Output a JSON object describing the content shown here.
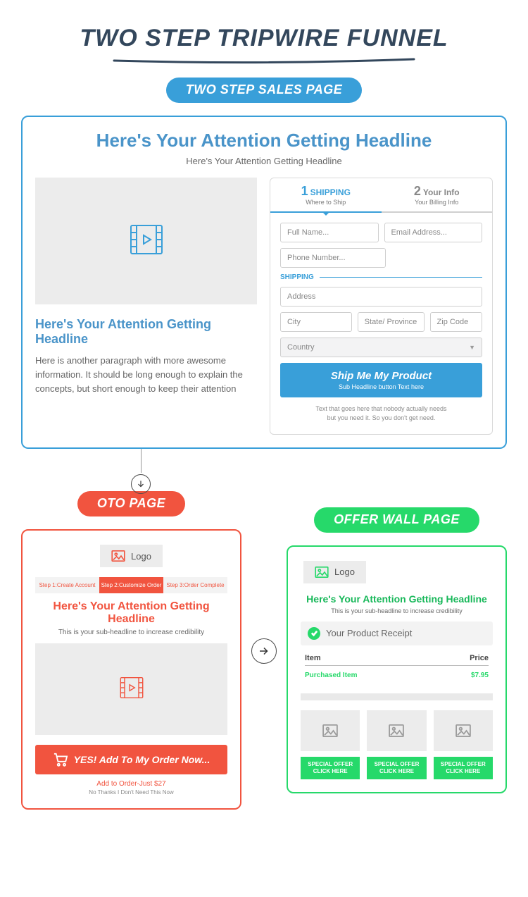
{
  "title": "Two Step Tripwire Funnel",
  "sales": {
    "pill": "Two Step Sales Page",
    "headline": "Here's Your Attention Getting Headline",
    "subhead": "Here's Your Attention Getting Headline",
    "left_headline": "Here's Your Attention Getting Headline",
    "left_para": "Here is another paragraph with more awesome information. It should be long enough to explain the concepts, but short enough to keep their attention",
    "tab1_num": "1",
    "tab1_title": "SHIPPING",
    "tab1_sub": "Where to Ship",
    "tab2_num": "2",
    "tab2_title": "Your Info",
    "tab2_sub": "Your Billing Info",
    "ph_fullname": "Full Name...",
    "ph_email": "Email Address...",
    "ph_phone": "Phone Number...",
    "ship_label": "SHIPPING",
    "ph_address": "Address",
    "ph_city": "City",
    "ph_state": "State/ Province",
    "ph_zip": "Zip Code",
    "ph_country": "Country",
    "btn_main": "Ship Me My Product",
    "btn_sub": "Sub Headline button Text here",
    "notice1": "Text that goes here that nobody actually needs",
    "notice2": "but you need it. So you don't get need."
  },
  "oto": {
    "pill": "OTO Page",
    "logo": "Logo",
    "step1": "Step 1:Create Account",
    "step2": "Step 2:Customize Order",
    "step3": "Step 3:Order Complete",
    "headline": "Here's Your Attention Getting Headline",
    "sub": "This is your sub-headline to increase credibility",
    "btn": "YES! Add To My Order Now...",
    "link": "Add to Order-Just $27",
    "link2": "No Thanks I Don't Need This Now"
  },
  "ow": {
    "pill": "Offer Wall Page",
    "logo": "Logo",
    "headline": "Here's Your Attention Getting Headline",
    "sub": "This is your sub-headline to increase credibility",
    "receipt": "Your Product Receipt",
    "th_item": "Item",
    "th_price": "Price",
    "item": "Purchased Item",
    "price": "$7.95",
    "offer_l1": "SPECIAL OFFER",
    "offer_l2": "CLICK HERE"
  }
}
